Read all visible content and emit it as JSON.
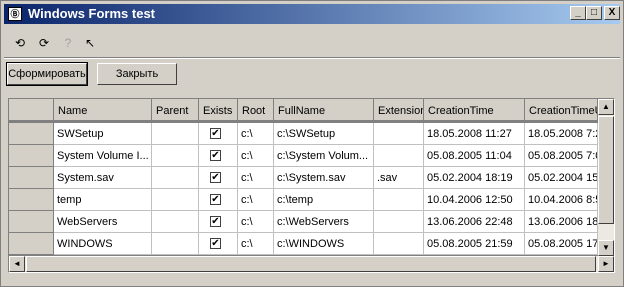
{
  "window": {
    "title": "Windows Forms test",
    "app_icon": "Ⓑ"
  },
  "title_buttons": {
    "minimize": "_",
    "maximize": "□",
    "close": "X"
  },
  "toolbar_icons": [
    {
      "name": "refresh-alpha-icon",
      "glyph": "⟲"
    },
    {
      "name": "refresh-beta-icon",
      "glyph": "⟳"
    },
    {
      "name": "help-disabled-icon",
      "glyph": "?"
    },
    {
      "name": "pointer-help-icon",
      "glyph": "↖"
    }
  ],
  "buttons": {
    "generate": "Сформировать",
    "close": "Закрыть"
  },
  "columns": [
    "",
    "Name",
    "Parent",
    "Exists",
    "Root",
    "FullName",
    "Extension",
    "CreationTime",
    "CreationTimeU"
  ],
  "rows": [
    {
      "name": "SWSetup",
      "parent": "",
      "exists": "✔",
      "root": "c:\\",
      "fullname": "c:\\SWSetup",
      "ext": "",
      "ctime": "18.05.2008 11:27",
      "ctimeu": "18.05.2008 7:2"
    },
    {
      "name": "System Volume I...",
      "parent": "",
      "exists": "✔",
      "root": "c:\\",
      "fullname": "c:\\System Volum...",
      "ext": "",
      "ctime": "05.08.2005 11:04",
      "ctimeu": "05.08.2005 7:0"
    },
    {
      "name": "System.sav",
      "parent": "",
      "exists": "✔",
      "root": "c:\\",
      "fullname": "c:\\System.sav",
      "ext": ".sav",
      "ctime": "05.02.2004 18:19",
      "ctimeu": "05.02.2004 15:"
    },
    {
      "name": "temp",
      "parent": "",
      "exists": "✔",
      "root": "c:\\",
      "fullname": "c:\\temp",
      "ext": "",
      "ctime": "10.04.2006 12:50",
      "ctimeu": "10.04.2006 8:5"
    },
    {
      "name": "WebServers",
      "parent": "",
      "exists": "✔",
      "root": "c:\\",
      "fullname": "c:\\WebServers",
      "ext": "",
      "ctime": "13.06.2006 22:48",
      "ctimeu": "13.06.2006 18:"
    },
    {
      "name": "WINDOWS",
      "parent": "",
      "exists": "✔",
      "root": "c:\\",
      "fullname": "c:\\WINDOWS",
      "ext": "",
      "ctime": "05.08.2005 21:59",
      "ctimeu": "05.08.2005 17:"
    }
  ],
  "scroll": {
    "up": "▲",
    "down": "▼",
    "left": "◄",
    "right": "►"
  }
}
